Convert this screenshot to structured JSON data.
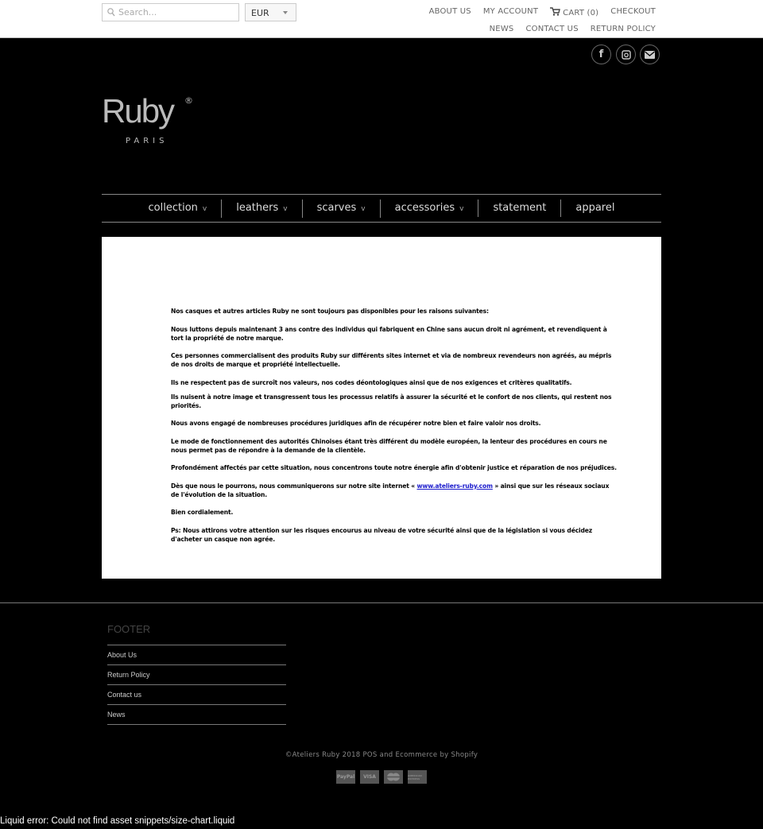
{
  "header": {
    "search_placeholder": "Search...",
    "currency": "EUR",
    "links_row1": [
      "ABOUT US",
      "MY ACCOUNT",
      "CART (0)",
      "CHECKOUT"
    ],
    "links_row2": [
      "NEWS",
      "CONTACT US",
      "RETURN POLICY"
    ]
  },
  "social": [
    "facebook-icon",
    "instagram-icon",
    "email-icon"
  ],
  "logo": {
    "name": "Ruby",
    "sub": "PARIS",
    "reg": "®"
  },
  "nav": [
    {
      "label": "collection",
      "dropdown": true
    },
    {
      "label": "leathers",
      "dropdown": true
    },
    {
      "label": "scarves",
      "dropdown": true
    },
    {
      "label": "accessories",
      "dropdown": true
    },
    {
      "label": "statement",
      "dropdown": false
    },
    {
      "label": "apparel",
      "dropdown": false
    }
  ],
  "nav_chevron": "v",
  "content": {
    "paragraphs": [
      "Nos casques et autres articles Ruby ne sont toujours pas disponibles pour les raisons suivantes:",
      "Nous luttons depuis maintenant 3 ans contre des individus qui fabriquent en Chine sans aucun droit ni agrément, et revendiquent à tort la propriété de notre marque.",
      "Ces personnes commercialisent des produits Ruby sur différents sites internet et via de nombreux revendeurs non agréés, au mépris de nos droits de marque et propriété intellectuelle.",
      "Ils ne respectent pas de surcroît nos valeurs, nos codes déontologiques ainsi que de nos exigences et critères qualitatifs.",
      "Ils nuisent à notre image et transgressent tous les processus relatifs à assurer la sécurité et le confort de nos clients, qui restent nos priorités.",
      "Nous avons engagé de nombreuses procédures juridiques afin de récupérer notre bien et faire valoir nos droits.",
      "Le mode de fonctionnement  des autorités Chinoises étant très différent du modèle européen, la lenteur des procédures en cours ne nous permet pas de répondre à la demande de la clientèle.",
      "Profondément affectés par cette situation, nous concentrons toute notre énergie afin d'obtenir justice et réparation de nos préjudices."
    ],
    "link_pre": "Dès que nous le pourrons, nous communiquerons sur notre site internet « ",
    "link_text": "www.ateliers-ruby.com",
    "link_post": " » ainsi que sur les réseaux sociaux de l'évolution de la situation.",
    "closing": "Bien cordialement.",
    "ps": "Ps: Nous attirons votre attention sur les risques encourus au niveau de votre sécurité ainsi que de la législation si vous décidez d'acheter un casque non agrée."
  },
  "footer": {
    "title": "FOOTER",
    "links": [
      "About Us",
      "Return Policy",
      "Contact us",
      "News"
    ],
    "copyright": "©Ateliers Ruby 2018 POS and Ecommerce by Shopify",
    "payments": [
      "PayPal",
      "VISA",
      "Mastercard",
      "American Express"
    ]
  },
  "error": "Liquid error: Could not find asset snippets/size-chart.liquid"
}
